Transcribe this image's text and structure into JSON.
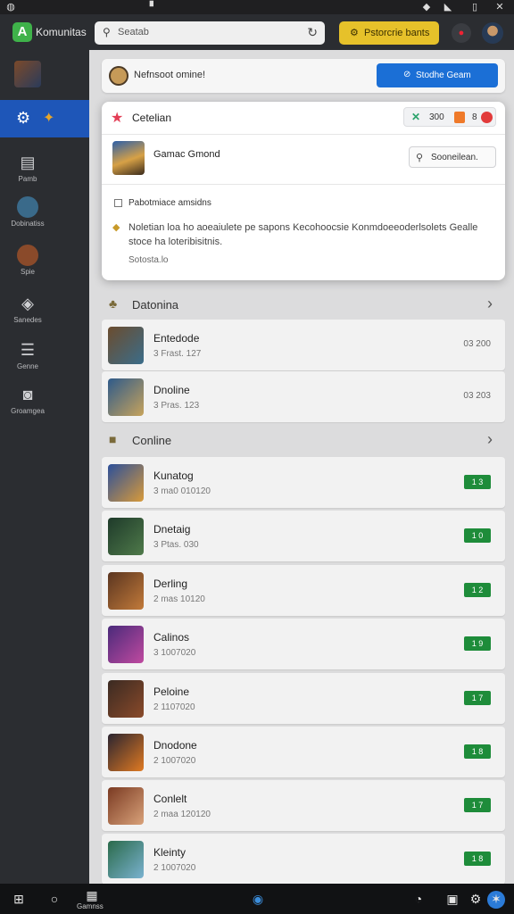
{
  "app": {
    "title": "Komunitas"
  },
  "search": {
    "text": "Seatab"
  },
  "header": {
    "promo_label": "Pstorcrie bants"
  },
  "status": {
    "text": "Nefnsoot omine!",
    "button_label": "Stodhe Geam"
  },
  "modal": {
    "title": "Cetelian",
    "pill_count": "300",
    "pill_count2": "8",
    "game_name": "Gamac Gmond",
    "select_label": "Sooneilean.",
    "checkbox_label": "Pabotmiace amsidns",
    "description": "Noletian loa ho aoeaiulete pe sapons Kecohoocsie Konmdoeeoderlsolets Gealle stoce ha loteribisitnis.",
    "link": "Sotosta.lo"
  },
  "sidebar": {
    "items": [
      {
        "label": "Pamb",
        "icon": "document-icon"
      },
      {
        "label": "Dobinatiss",
        "icon": "disc-icon"
      },
      {
        "label": "Spie",
        "icon": "portrait-icon"
      },
      {
        "label": "Sanedes",
        "icon": "tag-icon"
      },
      {
        "label": "Genne",
        "icon": "list-icon"
      },
      {
        "label": "Groamgea",
        "icon": "camera-icon"
      }
    ]
  },
  "sections": [
    {
      "title": "Datonina",
      "icon": "puzzle-icon",
      "rows": [
        {
          "name": "Entedode",
          "meta": "3 Frast. 127",
          "right": "03 200",
          "colors": [
            "#6b4c2e",
            "#3b6d8a"
          ]
        },
        {
          "name": "Dnoline",
          "meta": "3 Pras. 123",
          "right": "03 203",
          "colors": [
            "#2e5a8a",
            "#c7a35c"
          ]
        }
      ]
    },
    {
      "title": "Conline",
      "icon": "briefcase-icon",
      "rows": [
        {
          "name": "Kunatog",
          "meta": "3 ma0 010120",
          "badge": "1 3",
          "colors": [
            "#2b4f9a",
            "#d89a3a"
          ]
        },
        {
          "name": "Dnetaig",
          "meta": "3 Ptas. 030",
          "badge": "1 0",
          "colors": [
            "#1e3a2a",
            "#4f7a4a"
          ]
        },
        {
          "name": "Derling",
          "meta": "2 mas 10120",
          "badge": "1 2",
          "colors": [
            "#5a3520",
            "#c27a3a"
          ]
        },
        {
          "name": "Calinos",
          "meta": "3 1007020",
          "badge": "1 9",
          "colors": [
            "#4a2a7a",
            "#c04aa0"
          ]
        },
        {
          "name": "Peloine",
          "meta": "2 1107020",
          "badge": "1 7",
          "colors": [
            "#3a2a22",
            "#8a4a2a"
          ]
        },
        {
          "name": "Dnodone",
          "meta": "2 1007020",
          "badge": "1 8",
          "colors": [
            "#2a2430",
            "#e07a22"
          ]
        },
        {
          "name": "Conlelt",
          "meta": "2 maa 120120",
          "badge": "1 7",
          "colors": [
            "#7a3a22",
            "#d9a27a"
          ]
        },
        {
          "name": "Kleinty",
          "meta": "2 1007020",
          "badge": "1 8",
          "colors": [
            "#2a6a4a",
            "#7ab2d0"
          ]
        }
      ]
    }
  ],
  "taskbar": {
    "label": "Gamnss"
  }
}
